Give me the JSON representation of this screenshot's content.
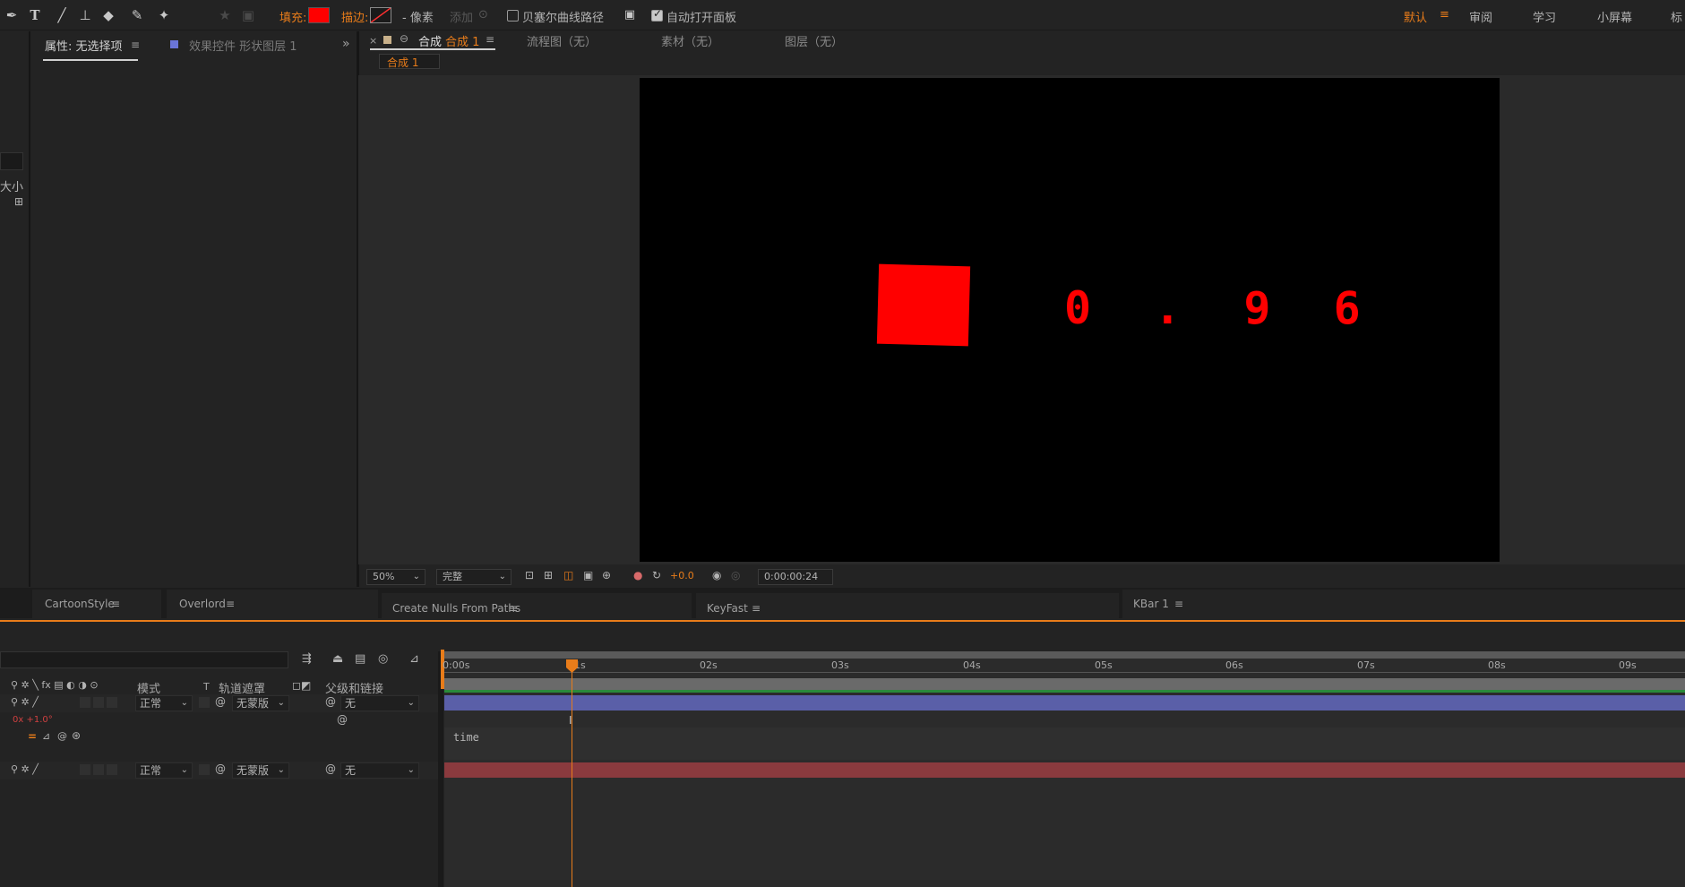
{
  "toolbar": {
    "fill_label": "填充:",
    "fill_color": "#ff0000",
    "stroke_label": "描边:",
    "stroke_units": "- 像素",
    "add_label": "添加",
    "bezier_label": "贝塞尔曲线路径",
    "auto_open_label": "自动打开面板",
    "workspaces": [
      "默认",
      "审阅",
      "学习",
      "小屏幕",
      "标"
    ],
    "active_workspace_color": "#e87c1a"
  },
  "left_panel": {
    "tab1": "属性: 无选择项",
    "tab2": "效果控件 形状图层 1",
    "size_label": "大小"
  },
  "comp_tabs": {
    "close": "×",
    "active_prefix": "合成",
    "active_name": "合成 1",
    "flowchart": "流程图（无）",
    "footage": "素材（无）",
    "layer": "图层（无）",
    "breadcrumb": "合成 1"
  },
  "canvas": {
    "display_text": "0 . 9 6"
  },
  "viewer_controls": {
    "zoom": "50%",
    "resolution": "完整",
    "exposure": "+0.0",
    "timecode": "0:00:00:24"
  },
  "extension_tabs": [
    "CartoonStyle",
    "Overlord",
    "Create Nulls From Paths",
    "KeyFast",
    "KBar 1"
  ],
  "timeline": {
    "columns": {
      "mode": "模式",
      "t": "T",
      "track_matte": "轨道遮罩",
      "parent": "父级和链接"
    },
    "layers": [
      {
        "mode": "正常",
        "matte": "无蒙版",
        "parent": "无"
      },
      {
        "mode": "正常",
        "matte": "无蒙版",
        "parent": "无"
      }
    ],
    "expression_value": "0x +1.0°",
    "expression_text": "time",
    "ruler": [
      "0:00s",
      "01s",
      "02s",
      "03s",
      "04s",
      "05s",
      "06s",
      "07s",
      "08s",
      "09s"
    ],
    "layer_colors": {
      "layer1": "#5a5fa8",
      "layer2": "#8a3a3e",
      "work_area": "#2a8a3a"
    }
  }
}
